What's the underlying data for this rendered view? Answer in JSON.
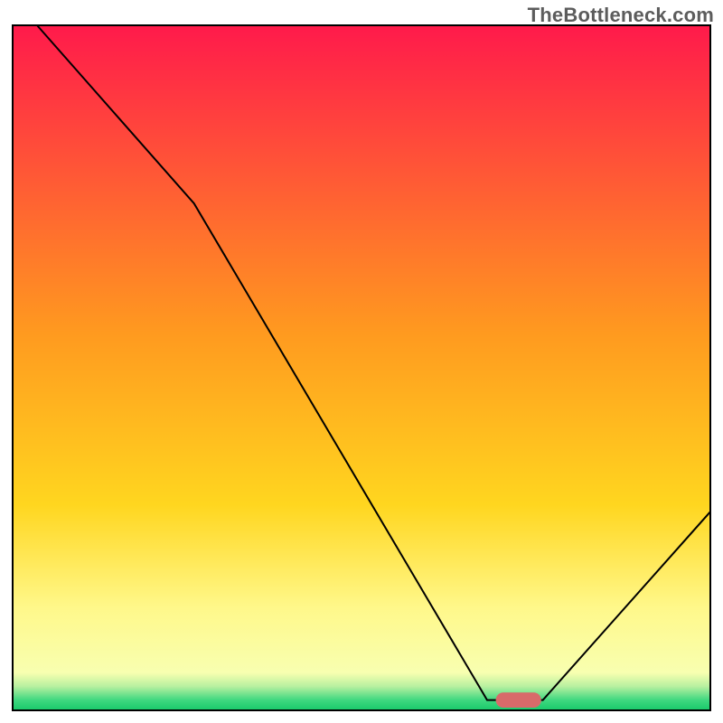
{
  "watermark": "TheBottleneck.com",
  "chart_data": {
    "type": "line",
    "title": "",
    "xlabel": "",
    "ylabel": "",
    "xlim": [
      0,
      100
    ],
    "ylim": [
      0,
      100
    ],
    "background_gradient": {
      "stops": [
        {
          "offset": 0.0,
          "color": "#ff1a4b"
        },
        {
          "offset": 0.45,
          "color": "#ff9a1f"
        },
        {
          "offset": 0.7,
          "color": "#ffd61f"
        },
        {
          "offset": 0.85,
          "color": "#fff88a"
        },
        {
          "offset": 0.945,
          "color": "#f8ffb0"
        },
        {
          "offset": 0.965,
          "color": "#b8f0a0"
        },
        {
          "offset": 0.985,
          "color": "#3fd880"
        },
        {
          "offset": 1.0,
          "color": "#18c96a"
        }
      ]
    },
    "border": {
      "color": "#000000",
      "width": 2
    },
    "curve": {
      "color": "#000000",
      "width": 2,
      "points": [
        {
          "x": 3.5,
          "y": 100.0
        },
        {
          "x": 26.0,
          "y": 74.0
        },
        {
          "x": 68.0,
          "y": 1.5
        },
        {
          "x": 76.0,
          "y": 1.5
        },
        {
          "x": 100.0,
          "y": 29.0
        }
      ]
    },
    "marker": {
      "shape": "pill",
      "center": {
        "x": 72.5,
        "y": 1.5
      },
      "width": 6.5,
      "height": 2.2,
      "fill": "#d86a6a"
    }
  }
}
